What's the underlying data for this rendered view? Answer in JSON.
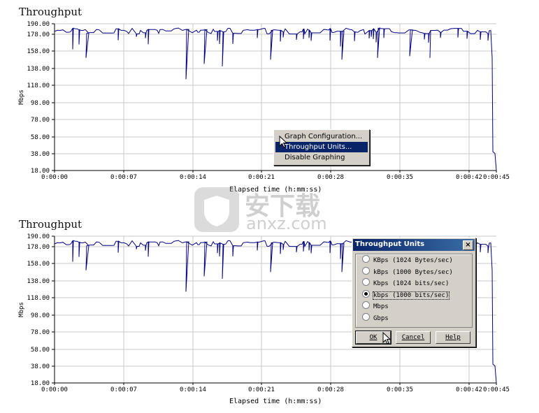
{
  "charts": [
    {
      "title": "Throughput",
      "ylabel": "Mbps",
      "xlabel": "Elapsed time (h:mm:ss)",
      "y_ticks": [
        "190.00",
        "178.00",
        "158.00",
        "138.00",
        "118.00",
        "98.00",
        "78.00",
        "58.00",
        "38.00",
        "18.00"
      ],
      "x_ticks": [
        "0:00:00",
        "0:00:07",
        "0:00:14",
        "0:00:21",
        "0:00:28",
        "0:00:35",
        "0:00:42",
        "0:00:45"
      ]
    },
    {
      "title": "Throughput",
      "ylabel": "Mbps",
      "xlabel": "Elapsed time (h:mm:ss)",
      "y_ticks": [
        "190.00",
        "178.00",
        "158.00",
        "138.00",
        "118.00",
        "98.00",
        "78.00",
        "58.00",
        "38.00",
        "18.00"
      ],
      "x_ticks": [
        "0:00:00",
        "0:00:07",
        "0:00:14",
        "0:00:21",
        "0:00:28",
        "0:00:35",
        "0:00:42",
        "0:00:45"
      ]
    }
  ],
  "context_menu": {
    "items": [
      "Graph Configuration...",
      "Throughput Units...",
      "Disable Graphing"
    ],
    "selected_index": 1
  },
  "dialog": {
    "title": "Throughput Units",
    "close_label": "×",
    "options": [
      {
        "label": "KBps  (1024 Bytes/sec)",
        "checked": false
      },
      {
        "label": "kBps  (1000 Bytes/sec)",
        "checked": false
      },
      {
        "label": "Kbps  (1024 bits/sec)",
        "checked": false
      },
      {
        "label": "kbps  (1000 bits/sec)",
        "checked": true
      },
      {
        "label": "Mbps",
        "checked": false
      },
      {
        "label": "Gbps",
        "checked": false
      }
    ],
    "buttons": {
      "ok": "OK",
      "cancel": "Cancel",
      "help": "Help"
    }
  },
  "watermark": {
    "main": "安下载",
    "sub": "anxz.com"
  },
  "chart_data": [
    {
      "type": "line",
      "title": "Throughput",
      "xlabel": "Elapsed time (h:mm:ss)",
      "ylabel": "Mbps",
      "ylim": [
        18,
        190
      ],
      "xlim_seconds": [
        0,
        45
      ],
      "grid": true,
      "series": [
        {
          "values_baseline": 183,
          "dip_values": [
            160,
            150,
            125,
            143,
            140,
            148,
            148,
            150,
            152,
            150
          ],
          "final_drop_to": 18
        }
      ]
    },
    {
      "type": "line",
      "title": "Throughput",
      "xlabel": "Elapsed time (h:mm:ss)",
      "ylabel": "Mbps",
      "ylim": [
        18,
        190
      ],
      "xlim_seconds": [
        0,
        45
      ],
      "grid": true,
      "series": [
        {
          "values_baseline": 183,
          "dip_values": [
            160,
            150,
            125,
            143,
            140,
            148,
            148,
            150,
            152,
            150
          ],
          "final_drop_to": 18
        }
      ]
    }
  ]
}
